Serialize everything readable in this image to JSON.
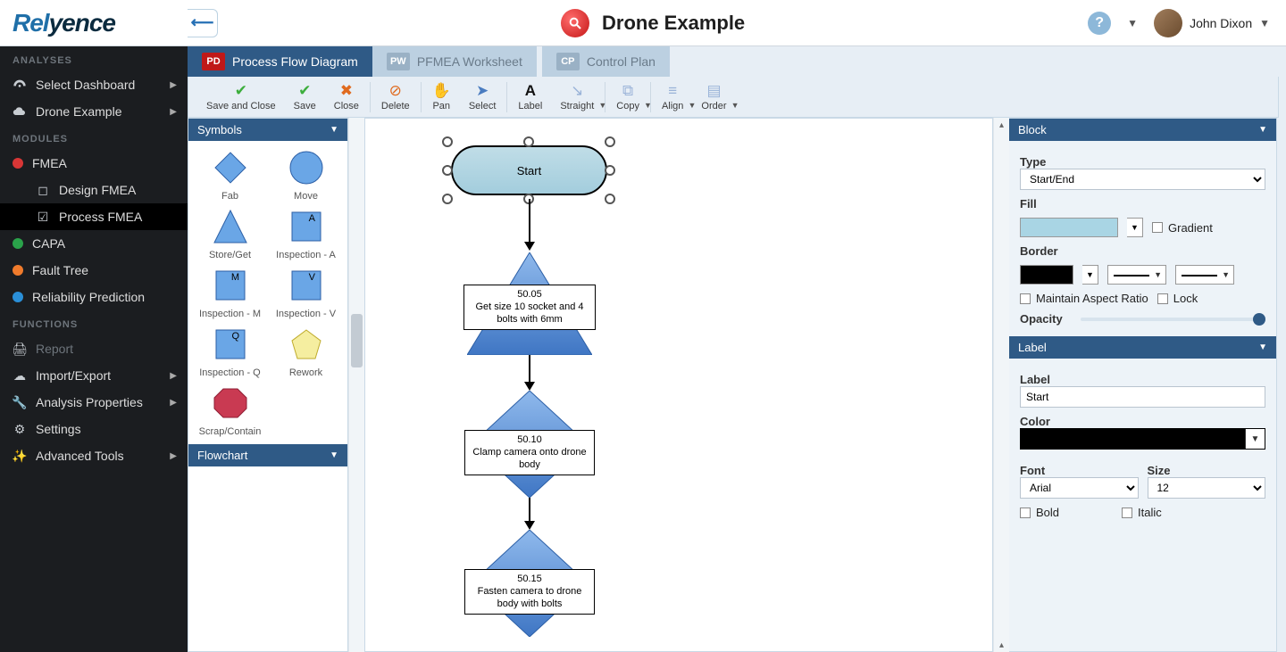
{
  "header": {
    "app_title": "Drone Example",
    "user_name": "John Dixon"
  },
  "sidebar": {
    "group_analyses": "ANALYSES",
    "group_modules": "MODULES",
    "group_functions": "FUNCTIONS",
    "select_dashboard": "Select Dashboard",
    "drone_example": "Drone Example",
    "fmea": "FMEA",
    "design_fmea": "Design FMEA",
    "process_fmea": "Process FMEA",
    "capa": "CAPA",
    "fault_tree": "Fault Tree",
    "reliability": "Reliability Prediction",
    "report": "Report",
    "import_export": "Import/Export",
    "analysis_props": "Analysis Properties",
    "settings": "Settings",
    "advanced_tools": "Advanced Tools"
  },
  "tabs": {
    "t1_badge": "PD",
    "t1_label": "Process Flow Diagram",
    "t2_badge": "PW",
    "t2_label": "PFMEA Worksheet",
    "t3_badge": "CP",
    "t3_label": "Control Plan"
  },
  "toolbar": {
    "save_close": "Save and Close",
    "save": "Save",
    "close": "Close",
    "delete": "Delete",
    "pan": "Pan",
    "select": "Select",
    "label": "Label",
    "straight": "Straight",
    "copy": "Copy",
    "align": "Align",
    "order": "Order"
  },
  "palette": {
    "symbols_hdr": "Symbols",
    "flowchart_hdr": "Flowchart",
    "fab": "Fab",
    "move": "Move",
    "store_get": "Store/Get",
    "inspection_a": "Inspection - A",
    "inspection_m": "Inspection - M",
    "inspection_v": "Inspection - V",
    "inspection_q": "Inspection - Q",
    "rework": "Rework",
    "scrap": "Scrap/Contain"
  },
  "flow": {
    "start": "Start",
    "n1_code": "50.05",
    "n1_text": "Get size 10 socket and 4 bolts with 6mm",
    "n2_code": "50.10",
    "n2_text": "Clamp camera onto drone body",
    "n3_code": "50.15",
    "n3_text": "Fasten camera to drone body with bolts"
  },
  "props": {
    "block_hdr": "Block",
    "label_hdr": "Label",
    "type_lbl": "Type",
    "type_val": "Start/End",
    "fill_lbl": "Fill",
    "gradient_lbl": "Gradient",
    "border_lbl": "Border",
    "maintain_ratio": "Maintain Aspect Ratio",
    "lock_lbl": "Lock",
    "opacity_lbl": "Opacity",
    "label_lbl": "Label",
    "label_val": "Start",
    "color_lbl": "Color",
    "font_lbl": "Font",
    "font_val": "Arial",
    "size_lbl": "Size",
    "size_val": "12",
    "bold_lbl": "Bold",
    "italic_lbl": "Italic",
    "fill_color": "#a9d5e4"
  }
}
